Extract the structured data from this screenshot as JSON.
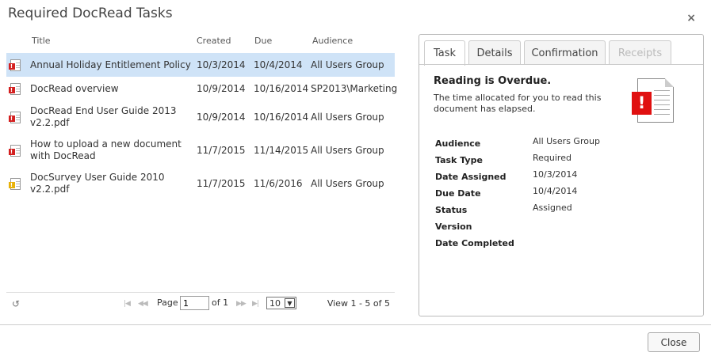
{
  "dialog": {
    "title": "Required DocRead Tasks",
    "close_glyph": "×"
  },
  "list": {
    "headers": {
      "title": "Title",
      "created": "Created",
      "due": "Due",
      "audience": "Audience"
    },
    "rows": [
      {
        "title": "Annual Holiday Entitlement Policy",
        "created": "10/3/2014",
        "due": "10/4/2014",
        "audience": "All Users Group",
        "icon": "overdue-document-icon",
        "selected": true
      },
      {
        "title": "DocRead overview",
        "created": "10/9/2014",
        "due": "10/16/2014",
        "audience": "SP2013\\Marketing",
        "icon": "overdue-document-icon"
      },
      {
        "title": "DocRead End User Guide 2013 v2.2.pdf",
        "created": "10/9/2014",
        "due": "10/16/2014",
        "audience": "All Users Group",
        "icon": "overdue-document-icon"
      },
      {
        "title": "How to upload a new document with DocRead",
        "created": "11/7/2015",
        "due": "11/14/2015",
        "audience": "All Users Group",
        "icon": "overdue-document-icon"
      },
      {
        "title": "DocSurvey User Guide 2010 v2.2.pdf",
        "created": "11/7/2015",
        "due": "11/6/2016",
        "audience": "All Users Group",
        "icon": "pending-document-icon"
      }
    ]
  },
  "pager": {
    "page_label": "Page",
    "page_value": "1",
    "of_label": "of 1",
    "page_size": "10",
    "view_label": "View 1 - 5 of 5"
  },
  "panel": {
    "tabs": [
      {
        "label": "Task",
        "active": true
      },
      {
        "label": "Details"
      },
      {
        "label": "Confirmation"
      },
      {
        "label": "Receipts",
        "disabled": true
      }
    ],
    "status_title": "Reading is Overdue.",
    "status_text": "The time allocated for you to read this document has elapsed.",
    "properties": [
      {
        "label": "Audience",
        "value": "All Users Group"
      },
      {
        "label": "Task Type",
        "value": "Required"
      },
      {
        "label": "Date Assigned",
        "value": "10/3/2014"
      },
      {
        "label": "Due Date",
        "value": "10/4/2014"
      },
      {
        "label": "Status",
        "value": "Assigned"
      },
      {
        "label": "Version",
        "value": ""
      },
      {
        "label": "Date Completed",
        "value": ""
      }
    ]
  },
  "footer": {
    "close_label": "Close"
  },
  "colors": {
    "selected_row": "#cfe3f7",
    "overdue_red": "#e01010",
    "pending_yellow": "#e8b20a"
  }
}
